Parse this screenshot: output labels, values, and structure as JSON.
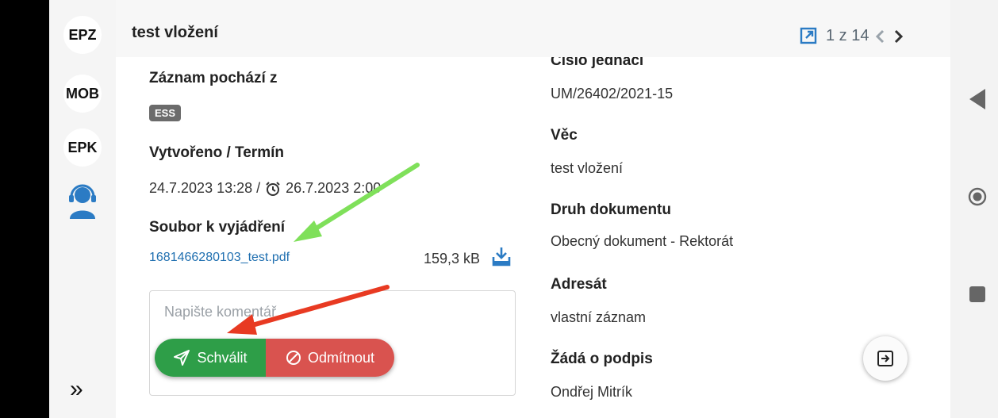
{
  "rail": {
    "items": [
      "EPZ",
      "MOB",
      "EPK"
    ],
    "expand_glyph": "»"
  },
  "header": {
    "title": "test vložení",
    "pager": "1 z 14"
  },
  "left": {
    "origin_label": "Záznam pochází z",
    "origin_badge": "ESS",
    "created_label": "Vytvořeno / Termín",
    "created_value": "24.7.2023 13:28 /",
    "deadline_value": "26.7.2023 2:00",
    "file_label": "Soubor k vyjádření",
    "file_name": "1681466280103_test.pdf",
    "file_size": "159,3 kB",
    "comment_placeholder": "Napište komentář",
    "approve_label": "Schválit",
    "reject_label": "Odmítnout"
  },
  "right": {
    "ref_label": "Číslo jednací",
    "ref_value": "UM/26402/2021-15",
    "subject_label": "Věc",
    "subject_value": "test vložení",
    "doctype_label": "Druh dokumentu",
    "doctype_value": "Obecný dokument - Rektorát",
    "addressee_label": "Adresát",
    "addressee_value": "vlastní záznam",
    "sign_label": "Žádá o podpis",
    "sign_value": "Ondřej Mitrík"
  },
  "colors": {
    "approve": "#2e9e48",
    "reject": "#d9534f",
    "link": "#1f6fb0",
    "annotation_green": "#7fe05a",
    "annotation_red": "#e83a22"
  },
  "icons": [
    "open-external-icon",
    "chevron-left-icon",
    "chevron-right-icon",
    "support-agent-icon",
    "alarm-icon",
    "download-icon",
    "send-icon",
    "block-icon",
    "exit-icon",
    "nav-back-icon",
    "nav-home-icon",
    "nav-recents-icon"
  ]
}
